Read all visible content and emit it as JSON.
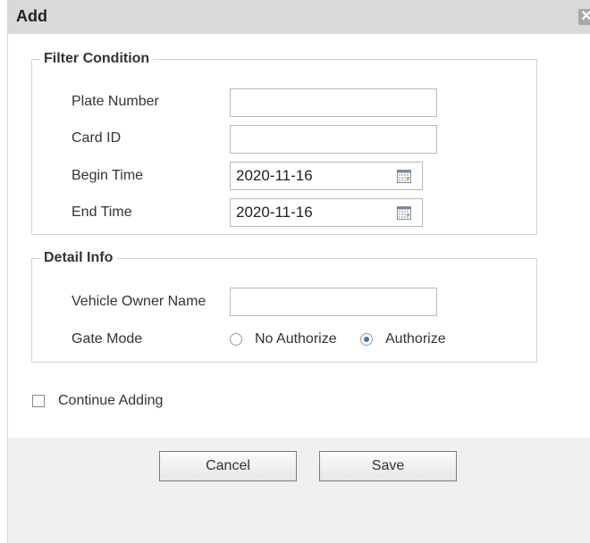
{
  "dialog": {
    "title": "Add",
    "close_glyph": "✕"
  },
  "filter_condition": {
    "legend": "Filter Condition",
    "plate_number": {
      "label": "Plate Number",
      "value": ""
    },
    "card_id": {
      "label": "Card ID",
      "value": ""
    },
    "begin_time": {
      "label": "Begin Time",
      "value": "2020-11-16",
      "icon": "calendar-icon"
    },
    "end_time": {
      "label": "End Time",
      "value": "2020-11-16",
      "icon": "calendar-icon"
    }
  },
  "detail_info": {
    "legend": "Detail Info",
    "vehicle_owner_name": {
      "label": "Vehicle Owner Name",
      "value": ""
    },
    "gate_mode": {
      "label": "Gate Mode",
      "options": [
        {
          "label": "No Authorize",
          "selected": false
        },
        {
          "label": "Authorize",
          "selected": true
        }
      ]
    }
  },
  "continue_adding": {
    "label": "Continue Adding",
    "checked": false
  },
  "buttons": {
    "cancel": "Cancel",
    "save": "Save"
  },
  "colors": {
    "titlebar": "#d9d9d9",
    "footer": "#f0f0f0",
    "radio_selected": "#3a7ac8"
  }
}
